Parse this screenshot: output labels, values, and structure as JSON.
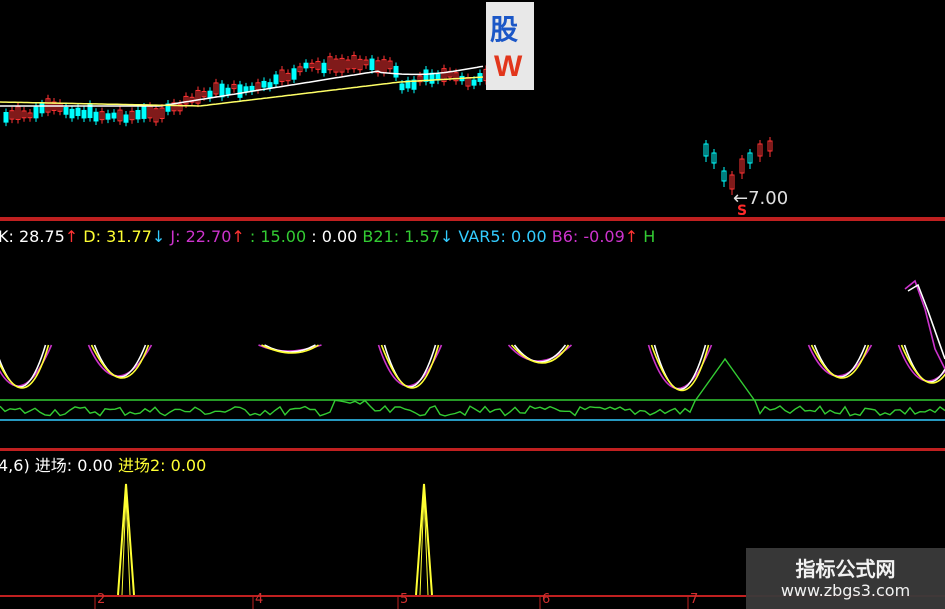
{
  "colors": {
    "up": "#ff3333",
    "down": "#00ffff",
    "ma1": "#ffffff",
    "ma2": "#ffff66",
    "k": "#ffffff",
    "d": "#ffff33",
    "j": "#cc33cc",
    "green": "#33cc33",
    "cyan": "#33ccff",
    "frame": "#c02020",
    "entry": "#ffff33"
  },
  "price_pane": {
    "logo_top": "股",
    "logo_bottom": "W",
    "low_label": "←7.00",
    "signal": "S"
  },
  "kdj_legend": [
    {
      "text": "K: 28.75",
      "color": "#ffffff"
    },
    {
      "text": "↑",
      "color": "#ff3333"
    },
    {
      "text": "  D: 31.77",
      "color": "#ffff33"
    },
    {
      "text": "↓",
      "color": "#33ccff"
    },
    {
      "text": "  J: 22.70",
      "color": "#cc33cc"
    },
    {
      "text": "↑",
      "color": "#ff3333"
    },
    {
      "text": "  : 15.00",
      "color": "#33cc33"
    },
    {
      "text": "  : 0.00",
      "color": "#ffffff"
    },
    {
      "text": "  B21: 1.57",
      "color": "#33cc33"
    },
    {
      "text": "↓",
      "color": "#33ccff"
    },
    {
      "text": "  VAR5: 0.00",
      "color": "#33ccff"
    },
    {
      "text": "  B6: -0.09",
      "color": "#cc33cc"
    },
    {
      "text": "↑",
      "color": "#ff3333"
    },
    {
      "text": "  H",
      "color": "#33cc33"
    }
  ],
  "entry_legend": [
    {
      "text": "4,6)",
      "color": "#ffffff"
    },
    {
      "text": "  进场: 0.00",
      "color": "#ffffff"
    },
    {
      "text": "  进场2: 0.00",
      "color": "#ffff33"
    }
  ],
  "x_axis_labels": [
    "2",
    "4",
    "5",
    "6",
    "7"
  ],
  "watermark": {
    "line1": "指标公式网",
    "line2": "www.zbgs3.com"
  }
}
